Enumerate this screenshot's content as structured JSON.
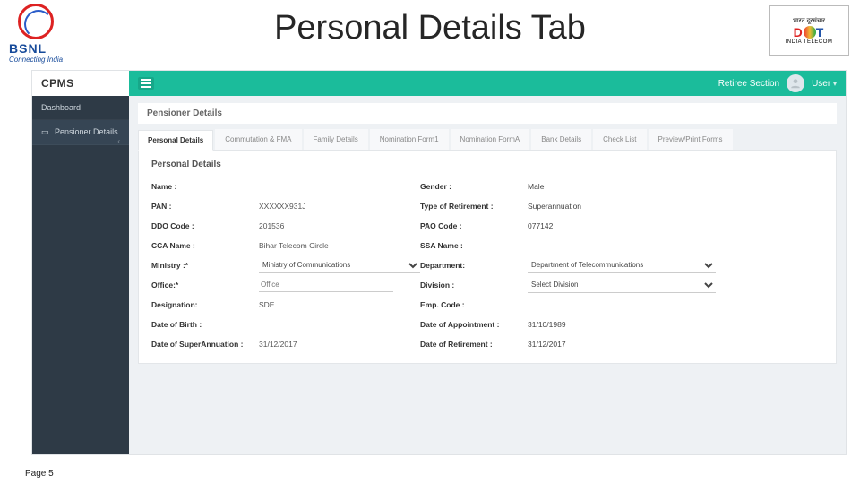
{
  "slide": {
    "title": "Personal Details Tab",
    "footer": "Page 5"
  },
  "logo_left": {
    "brand": "BSNL",
    "tag": "Connecting India"
  },
  "logo_right": {
    "top": "भारत दूरसंचार",
    "brand_d": "D",
    "brand_t": "T",
    "sub": "INDIA TELECOM"
  },
  "app": {
    "brand": "CPMS",
    "topbar": {
      "retiree": "Retiree Section",
      "user": "User"
    },
    "sidebar": {
      "items": [
        {
          "label": "Dashboard"
        },
        {
          "label": "Pensioner Details",
          "icon": "id",
          "chev": "‹"
        }
      ]
    },
    "crumb": "Pensioner Details",
    "tabs": [
      "Personal Details",
      "Commutation & FMA",
      "Family Details",
      "Nomination Form1",
      "Nomination FormA",
      "Bank Details",
      "Check List",
      "Preview/Print Forms"
    ],
    "card_title": "Personal Details",
    "form": {
      "name": {
        "label": "Name :",
        "value": ""
      },
      "gender": {
        "label": "Gender :",
        "value": "Male"
      },
      "pan": {
        "label": "PAN :",
        "value": "XXXXXX931J"
      },
      "retire_type": {
        "label": "Type of Retirement :",
        "value": "Superannuation"
      },
      "ddo": {
        "label": "DDO Code :",
        "value": "201536"
      },
      "pao": {
        "label": "PAO Code :",
        "value": "077142"
      },
      "cca": {
        "label": "CCA Name :",
        "value": "Bihar Telecom Circle"
      },
      "ssa": {
        "label": "SSA Name :",
        "value": ""
      },
      "ministry": {
        "label": "Ministry :*",
        "value": "Ministry of Communications"
      },
      "dept": {
        "label": "Department:",
        "value": "Department of Telecommunications"
      },
      "office": {
        "label": "Office:*",
        "placeholder": "Office"
      },
      "division": {
        "label": "Division :",
        "value": "Select Division"
      },
      "desig": {
        "label": "Designation:",
        "value": "SDE"
      },
      "emp": {
        "label": "Emp. Code :",
        "value": ""
      },
      "dob": {
        "label": "Date of Birth :",
        "value": ""
      },
      "doa": {
        "label": "Date of Appointment :",
        "value": "31/10/1989"
      },
      "dos": {
        "label": "Date of SuperAnnuation :",
        "value": "31/12/2017"
      },
      "dor": {
        "label": "Date of Retirement :",
        "value": "31/12/2017"
      }
    }
  }
}
